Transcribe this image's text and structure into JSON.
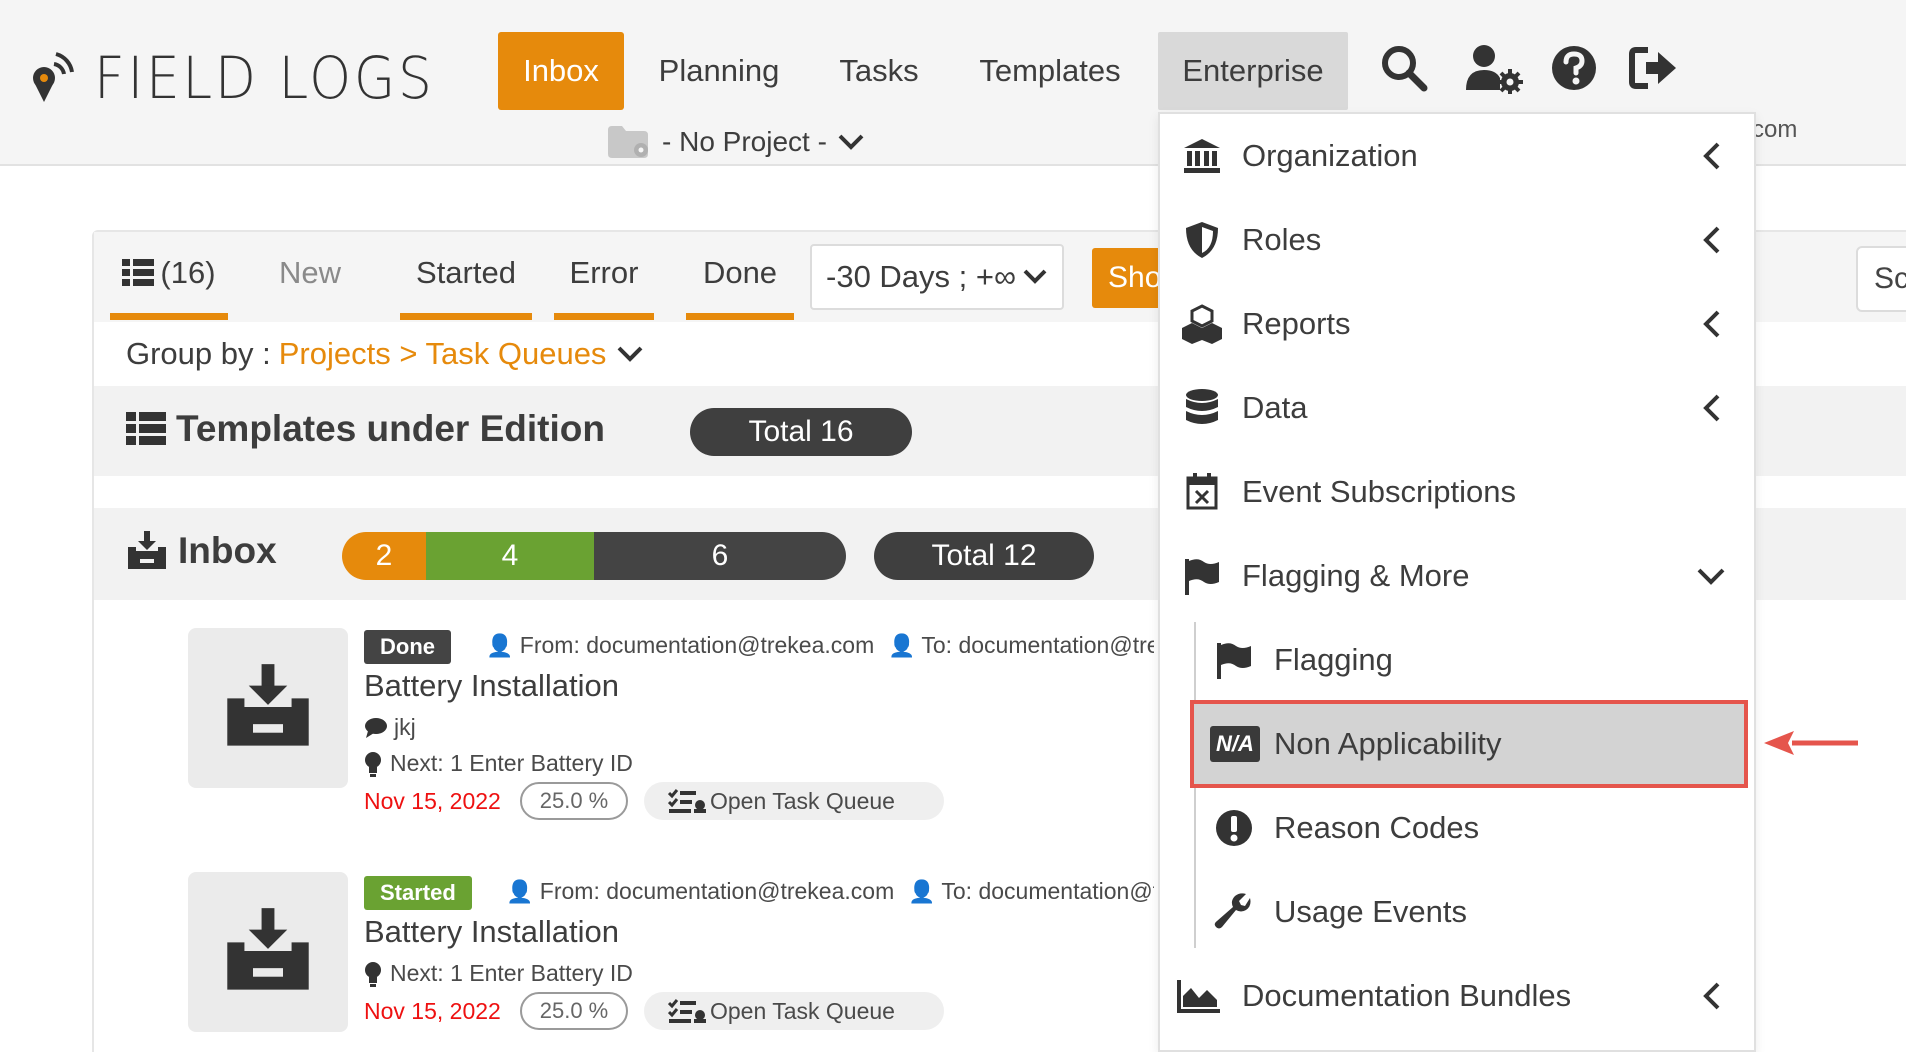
{
  "brand": {
    "name": "FIELD LOGS"
  },
  "nav": {
    "inbox": "Inbox",
    "planning": "Planning",
    "tasks": "Tasks",
    "templates": "Templates",
    "enterprise": "Enterprise"
  },
  "header_icons": [
    "search-icon",
    "user-settings-icon",
    "help-icon",
    "logout-icon"
  ],
  "project_selector": {
    "label": "- No Project -"
  },
  "user_email_fragment": "com",
  "filters": {
    "all_count": "(16)",
    "tabs": [
      "New",
      "Started",
      "Error",
      "Done"
    ],
    "range": "-30 Days ; +∞",
    "show_button": "Sho",
    "search_fragment": "Sc"
  },
  "group_by": {
    "label": "Group by :",
    "value": "Projects > Task Queues"
  },
  "sections": {
    "templates": {
      "title": "Templates under Edition",
      "total": "Total 16"
    },
    "inbox": {
      "title": "Inbox",
      "segments": [
        {
          "value": "2",
          "color": "#e68a0c"
        },
        {
          "value": "4",
          "color": "#6aa232"
        },
        {
          "value": "6",
          "color": "#444444"
        }
      ],
      "total": "Total 12"
    }
  },
  "tasks": [
    {
      "status": "Done",
      "status_color": "#444444",
      "from": "From: documentation@trekea.com",
      "to": "To: documentation@tre",
      "title": "Battery Installation",
      "comment": "jkj",
      "next": "Next: 1 Enter Battery ID",
      "date": "Nov 15, 2022",
      "percent": "25.0 %",
      "queue": "Open Task Queue"
    },
    {
      "status": "Started",
      "status_color": "#6aa232",
      "from": "From: documentation@trekea.com",
      "to": "To: documentation@t",
      "title": "Battery Installation",
      "comment": "",
      "next": "Next: 1 Enter Battery ID",
      "date": "Nov 15, 2022",
      "percent": "25.0 %",
      "queue": "Open Task Queue"
    }
  ],
  "enterprise_menu": {
    "items": [
      {
        "label": "Organization",
        "icon": "bank-icon",
        "chevron": "left"
      },
      {
        "label": "Roles",
        "icon": "shield-icon",
        "chevron": "left"
      },
      {
        "label": "Reports",
        "icon": "cubes-icon",
        "chevron": "left"
      },
      {
        "label": "Data",
        "icon": "database-icon",
        "chevron": "left"
      },
      {
        "label": "Event Subscriptions",
        "icon": "calendar-x-icon",
        "chevron": "none"
      },
      {
        "label": "Flagging & More",
        "icon": "flag-icon",
        "chevron": "down"
      }
    ],
    "subitems": [
      {
        "label": "Flagging",
        "icon": "flag-icon"
      },
      {
        "label": "Non Applicability",
        "icon": "na-icon",
        "na_text": "N/A",
        "highlighted": true
      },
      {
        "label": "Reason Codes",
        "icon": "exclamation-circle-icon"
      },
      {
        "label": "Usage Events",
        "icon": "wrench-icon"
      }
    ],
    "last": {
      "label": "Documentation Bundles",
      "icon": "area-chart-icon",
      "chevron": "left"
    }
  },
  "colors": {
    "accent": "#e68a0c",
    "highlight_border": "#e5554c",
    "success": "#6aa232",
    "dark": "#3f3f3f",
    "date_red": "#e11111"
  }
}
